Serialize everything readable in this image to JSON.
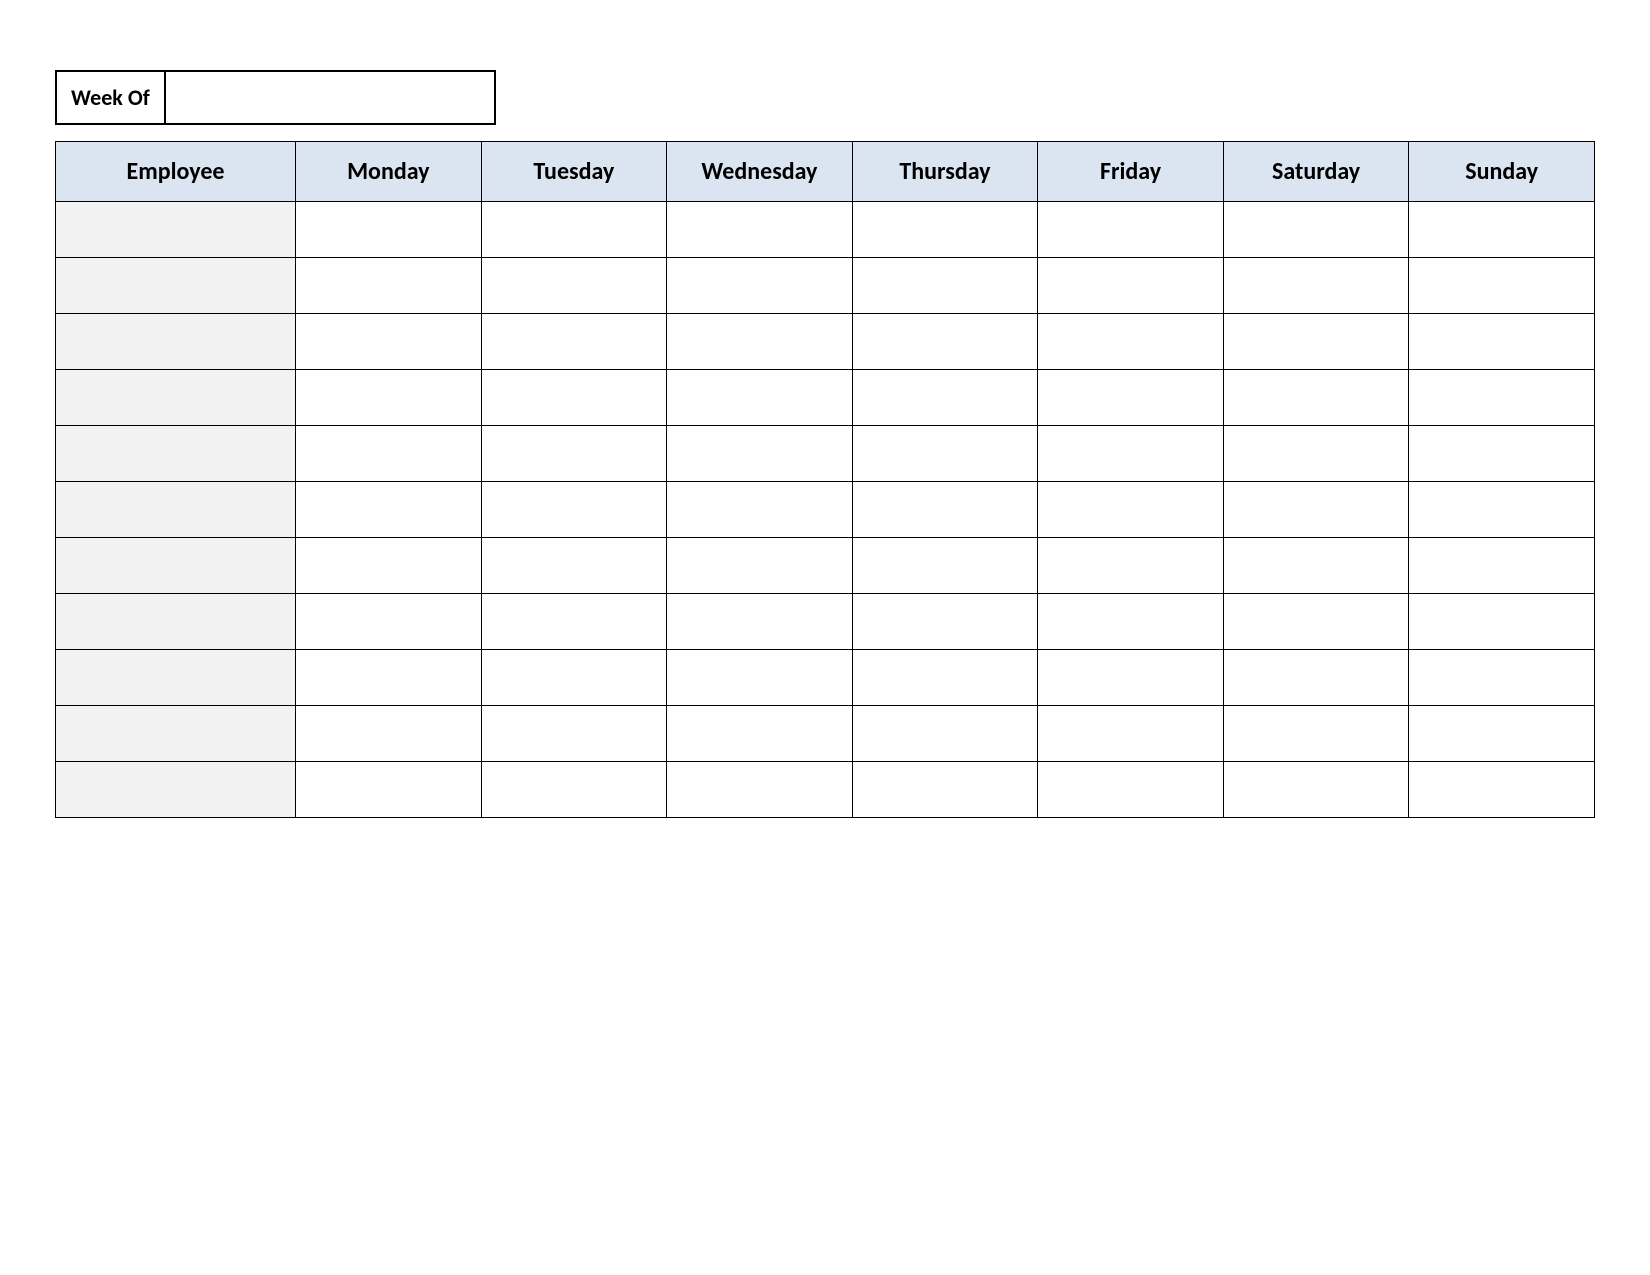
{
  "weekof": {
    "label": "Week Of",
    "value": ""
  },
  "headers": {
    "employee": "Employee",
    "days": [
      "Monday",
      "Tuesday",
      "Wednesday",
      "Thursday",
      "Friday",
      "Saturday",
      "Sunday"
    ]
  },
  "rows": [
    {
      "employee": "",
      "cells": [
        "",
        "",
        "",
        "",
        "",
        "",
        ""
      ]
    },
    {
      "employee": "",
      "cells": [
        "",
        "",
        "",
        "",
        "",
        "",
        ""
      ]
    },
    {
      "employee": "",
      "cells": [
        "",
        "",
        "",
        "",
        "",
        "",
        ""
      ]
    },
    {
      "employee": "",
      "cells": [
        "",
        "",
        "",
        "",
        "",
        "",
        ""
      ]
    },
    {
      "employee": "",
      "cells": [
        "",
        "",
        "",
        "",
        "",
        "",
        ""
      ]
    },
    {
      "employee": "",
      "cells": [
        "",
        "",
        "",
        "",
        "",
        "",
        ""
      ]
    },
    {
      "employee": "",
      "cells": [
        "",
        "",
        "",
        "",
        "",
        "",
        ""
      ]
    },
    {
      "employee": "",
      "cells": [
        "",
        "",
        "",
        "",
        "",
        "",
        ""
      ]
    },
    {
      "employee": "",
      "cells": [
        "",
        "",
        "",
        "",
        "",
        "",
        ""
      ]
    },
    {
      "employee": "",
      "cells": [
        "",
        "",
        "",
        "",
        "",
        "",
        ""
      ]
    },
    {
      "employee": "",
      "cells": [
        "",
        "",
        "",
        "",
        "",
        "",
        ""
      ]
    }
  ]
}
